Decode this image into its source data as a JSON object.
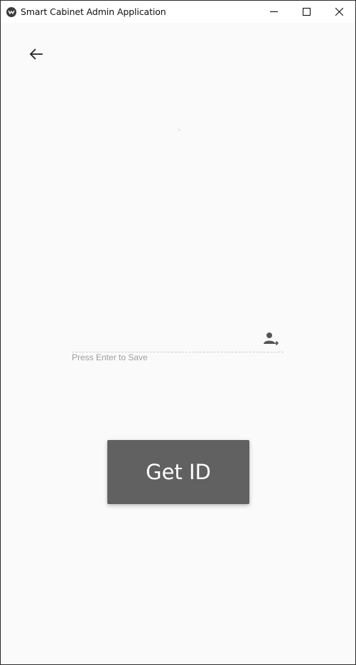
{
  "window": {
    "title": "Smart Cabinet Admin Application",
    "app_icon": "app-logo-icon",
    "controls": {
      "minimize_icon": "minimize-icon",
      "maximize_icon": "maximize-icon",
      "close_icon": "close-icon"
    }
  },
  "nav": {
    "back_icon": "arrow-left-icon"
  },
  "id_field": {
    "value": "",
    "placeholder": "",
    "helper_text": "Press Enter to Save",
    "trailing_icon": "account-arrow-right-icon"
  },
  "actions": {
    "get_id_label": "Get ID",
    "get_id_color": "#616161"
  },
  "colors": {
    "background": "#fafafa",
    "helper_text": "#9e9e9e"
  }
}
